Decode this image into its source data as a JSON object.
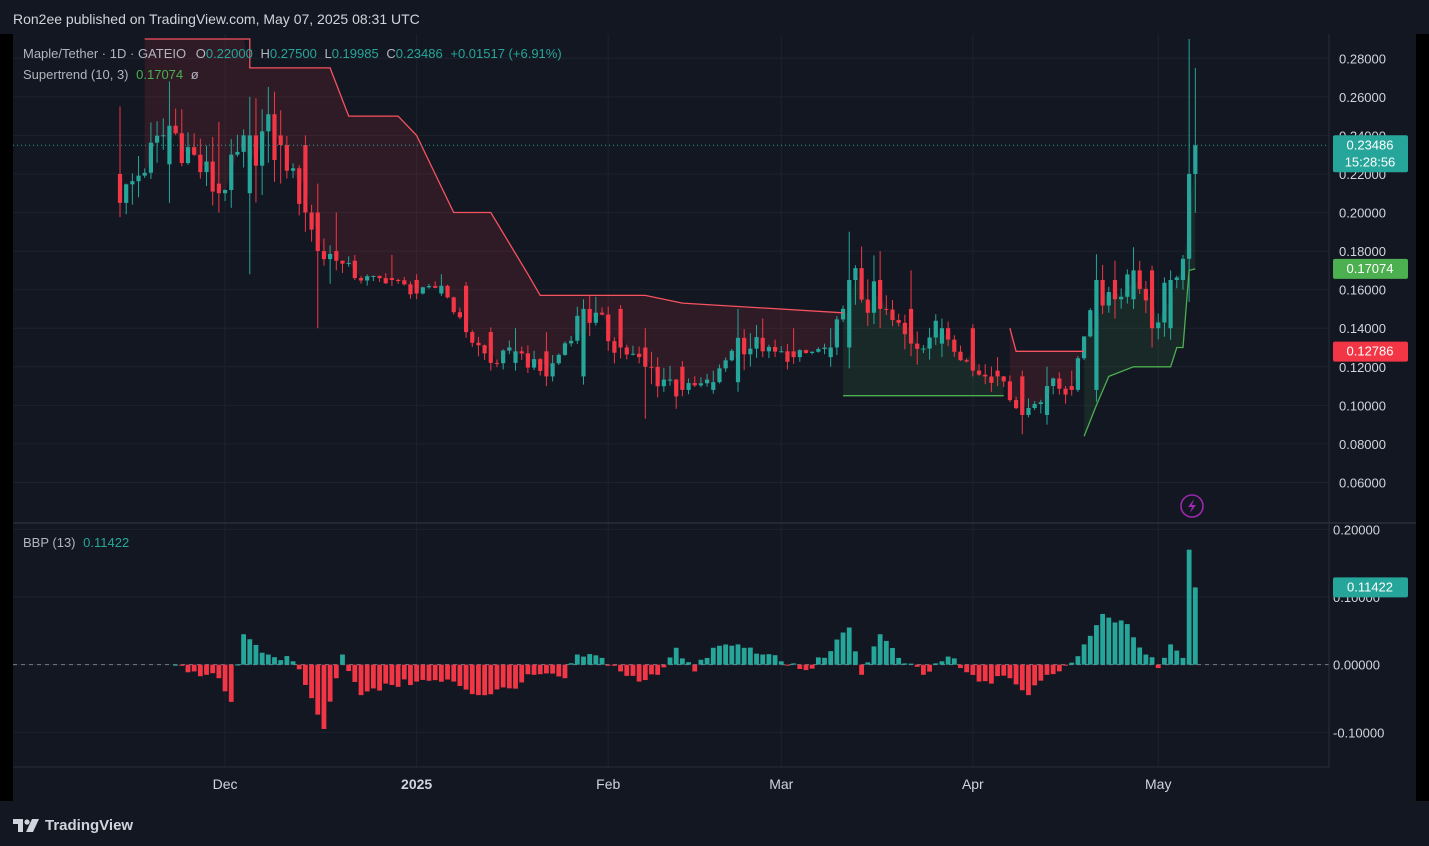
{
  "header": {
    "published_text": "Ron2ee published on TradingView.com, May 07, 2025 08:31 UTC"
  },
  "footer": {
    "brand": "TradingView"
  },
  "symbol": {
    "name": "Maple/Tether",
    "interval": "1D",
    "exchange": "GATEIO",
    "open_label": "O",
    "open": "0.22000",
    "high_label": "H",
    "high": "0.27500",
    "low_label": "L",
    "low": "0.19985",
    "close_label": "C",
    "close": "0.23486",
    "change": "+0.01517 (+6.91%)"
  },
  "supertrend": {
    "label": "Supertrend (10, 3)",
    "value": "0.17074",
    "suffix": "ø"
  },
  "bbp": {
    "label": "BBP (13)",
    "value": "0.11422"
  },
  "price_tags": {
    "last_price": "0.23486",
    "countdown": "15:28:56",
    "supertrend": "0.17074",
    "other": "0.12786"
  },
  "colors": {
    "up": "#26a69a",
    "down": "#f23645",
    "supertrend_up": "#4caf50",
    "supertrend_down": "#f7525f",
    "background": "#131722",
    "grid": "#1e222d"
  },
  "chart_data": {
    "type": "candlestick",
    "title": "Maple/Tether · 1D · GATEIO",
    "x_tick_labels": [
      "Dec",
      "2025",
      "Feb",
      "Mar",
      "Apr",
      "May"
    ],
    "x_tick_dates": [
      "2024-12-01",
      "2025-01-01",
      "2025-02-01",
      "2025-03-01",
      "2025-04-01",
      "2025-05-01"
    ],
    "price_axis": {
      "ticks": [
        "0.06000",
        "0.08000",
        "0.10000",
        "0.12000",
        "0.14000",
        "0.16000",
        "0.18000",
        "0.20000",
        "0.22000",
        "0.24000",
        "0.26000",
        "0.28000"
      ],
      "ylim": [
        0.04,
        0.29
      ]
    },
    "bbp_axis": {
      "ticks": [
        "-0.10000",
        "0.00000",
        "0.10000",
        "0.20000"
      ],
      "ylim": [
        -0.135,
        0.205
      ]
    },
    "anchors": [
      [
        "2024-11-14",
        0.22,
        0.255,
        0.2,
        0.205
      ],
      [
        "2024-11-22",
        0.225,
        0.268,
        0.205,
        0.245
      ],
      [
        "2024-11-30",
        0.215,
        0.247,
        0.2,
        0.21
      ],
      [
        "2024-12-05",
        0.21,
        0.26,
        0.168,
        0.24
      ],
      [
        "2024-12-10",
        0.24,
        0.253,
        0.215,
        0.235
      ],
      [
        "2024-12-14",
        0.235,
        0.24,
        0.19,
        0.2
      ],
      [
        "2024-12-16",
        0.2,
        0.215,
        0.14,
        0.18
      ],
      [
        "2024-12-19",
        0.18,
        0.2,
        0.17,
        0.175
      ],
      [
        "2024-12-22",
        0.175,
        0.178,
        0.165,
        0.166
      ],
      [
        "2024-12-28",
        0.166,
        0.178,
        0.163,
        0.165
      ],
      [
        "2025-01-01",
        0.165,
        0.168,
        0.155,
        0.158
      ],
      [
        "2025-01-05",
        0.158,
        0.168,
        0.157,
        0.162
      ],
      [
        "2025-01-09",
        0.162,
        0.163,
        0.135,
        0.138
      ],
      [
        "2025-01-13",
        0.138,
        0.14,
        0.118,
        0.122
      ],
      [
        "2025-01-17",
        0.122,
        0.14,
        0.118,
        0.128
      ],
      [
        "2025-01-22",
        0.128,
        0.138,
        0.11,
        0.115
      ],
      [
        "2025-01-28",
        0.115,
        0.155,
        0.113,
        0.15
      ],
      [
        "2025-02-03",
        0.15,
        0.152,
        0.125,
        0.13
      ],
      [
        "2025-02-07",
        0.13,
        0.14,
        0.093,
        0.12
      ],
      [
        "2025-02-13",
        0.12,
        0.123,
        0.105,
        0.108
      ],
      [
        "2025-02-18",
        0.108,
        0.118,
        0.106,
        0.112
      ],
      [
        "2025-02-22",
        0.112,
        0.15,
        0.108,
        0.135
      ],
      [
        "2025-02-26",
        0.135,
        0.145,
        0.125,
        0.128
      ],
      [
        "2025-03-03",
        0.128,
        0.14,
        0.122,
        0.125
      ],
      [
        "2025-03-09",
        0.125,
        0.14,
        0.12,
        0.13
      ],
      [
        "2025-03-12",
        0.13,
        0.19,
        0.125,
        0.165
      ],
      [
        "2025-03-17",
        0.165,
        0.18,
        0.14,
        0.15
      ],
      [
        "2025-03-22",
        0.15,
        0.17,
        0.13,
        0.132
      ],
      [
        "2025-03-27",
        0.132,
        0.145,
        0.125,
        0.14
      ],
      [
        "2025-04-01",
        0.14,
        0.142,
        0.115,
        0.118
      ],
      [
        "2025-04-05",
        0.118,
        0.125,
        0.11,
        0.115
      ],
      [
        "2025-04-09",
        0.115,
        0.118,
        0.085,
        0.095
      ],
      [
        "2025-04-13",
        0.095,
        0.12,
        0.09,
        0.11
      ],
      [
        "2025-04-17",
        0.11,
        0.118,
        0.105,
        0.108
      ],
      [
        "2025-04-21",
        0.108,
        0.17,
        0.105,
        0.165
      ],
      [
        "2025-04-24",
        0.165,
        0.175,
        0.145,
        0.155
      ],
      [
        "2025-04-27",
        0.155,
        0.182,
        0.15,
        0.17
      ],
      [
        "2025-04-30",
        0.17,
        0.172,
        0.13,
        0.14
      ],
      [
        "2025-05-03",
        0.14,
        0.17,
        0.138,
        0.165
      ],
      [
        "2025-05-05",
        0.165,
        0.178,
        0.16,
        0.176
      ],
      [
        "2025-05-06",
        0.176,
        0.29,
        0.17,
        0.22
      ],
      [
        "2025-05-07",
        0.22,
        0.275,
        0.19985,
        0.23486
      ]
    ],
    "supertrend": {
      "down_segments": [
        [
          [
            "2024-11-18",
            0.29
          ],
          [
            "2024-12-05",
            0.29
          ],
          [
            "2024-12-05",
            0.275
          ],
          [
            "2024-12-18",
            0.275
          ],
          [
            "2024-12-21",
            0.25
          ],
          [
            "2024-12-29",
            0.25
          ],
          [
            "2025-01-01",
            0.24
          ],
          [
            "2025-01-07",
            0.2
          ],
          [
            "2025-01-13",
            0.2
          ],
          [
            "2025-01-19",
            0.168
          ],
          [
            "2025-01-21",
            0.157
          ],
          [
            "2025-02-07",
            0.157
          ],
          [
            "2025-02-13",
            0.153
          ],
          [
            "2025-03-11",
            0.148
          ]
        ],
        [
          [
            "2025-04-07",
            0.14
          ],
          [
            "2025-04-08",
            0.128
          ],
          [
            "2025-04-17",
            0.128
          ],
          [
            "2025-04-19",
            0.128
          ]
        ]
      ],
      "up_segments": [
        [
          [
            "2025-03-11",
            0.105
          ],
          [
            "2025-04-06",
            0.105
          ]
        ],
        [
          [
            "2025-04-19",
            0.084
          ],
          [
            "2025-04-21",
            0.1
          ],
          [
            "2025-04-23",
            0.115
          ],
          [
            "2025-04-27",
            0.12
          ],
          [
            "2025-05-03",
            0.12
          ],
          [
            "2025-05-04",
            0.13
          ],
          [
            "2025-05-05",
            0.13
          ],
          [
            "2025-05-06",
            0.17
          ],
          [
            "2025-05-07",
            0.17074
          ]
        ]
      ]
    },
    "bbp_anchors": [
      [
        "2024-11-23",
        0.0
      ],
      [
        "2024-11-26",
        -0.01
      ],
      [
        "2024-11-28",
        -0.015
      ],
      [
        "2024-11-30",
        -0.02
      ],
      [
        "2024-12-02",
        -0.055
      ],
      [
        "2024-12-04",
        0.045
      ],
      [
        "2024-12-08",
        0.015
      ],
      [
        "2024-12-12",
        0.005
      ],
      [
        "2024-12-14",
        -0.03
      ],
      [
        "2024-12-17",
        -0.095
      ],
      [
        "2024-12-20",
        0.015
      ],
      [
        "2024-12-23",
        -0.045
      ],
      [
        "2024-12-28",
        -0.03
      ],
      [
        "2025-01-01",
        -0.025
      ],
      [
        "2025-01-07",
        -0.025
      ],
      [
        "2025-01-11",
        -0.045
      ],
      [
        "2025-01-16",
        -0.035
      ],
      [
        "2025-01-20",
        -0.015
      ],
      [
        "2025-01-25",
        -0.02
      ],
      [
        "2025-01-27",
        0.015
      ],
      [
        "2025-01-31",
        0.01
      ],
      [
        "2025-02-03",
        -0.01
      ],
      [
        "2025-02-06",
        -0.025
      ],
      [
        "2025-02-09",
        -0.015
      ],
      [
        "2025-02-12",
        0.025
      ],
      [
        "2025-02-15",
        -0.01
      ],
      [
        "2025-02-18",
        0.025
      ],
      [
        "2025-02-22",
        0.03
      ],
      [
        "2025-02-26",
        0.015
      ],
      [
        "2025-03-01",
        0.005
      ],
      [
        "2025-03-05",
        -0.008
      ],
      [
        "2025-03-09",
        0.02
      ],
      [
        "2025-03-12",
        0.055
      ],
      [
        "2025-03-14",
        -0.015
      ],
      [
        "2025-03-17",
        0.045
      ],
      [
        "2025-03-20",
        0.01
      ],
      [
        "2025-03-24",
        -0.015
      ],
      [
        "2025-03-28",
        0.012
      ],
      [
        "2025-03-30",
        -0.005
      ],
      [
        "2025-04-02",
        -0.025
      ],
      [
        "2025-04-07",
        -0.02
      ],
      [
        "2025-04-10",
        -0.045
      ],
      [
        "2025-04-13",
        -0.015
      ],
      [
        "2025-04-17",
        0.003
      ],
      [
        "2025-04-19",
        0.03
      ],
      [
        "2025-04-22",
        0.075
      ],
      [
        "2025-04-26",
        0.06
      ],
      [
        "2025-04-29",
        0.015
      ],
      [
        "2025-05-01",
        -0.005
      ],
      [
        "2025-05-03",
        0.03
      ],
      [
        "2025-05-05",
        0.01
      ],
      [
        "2025-05-06",
        0.17
      ],
      [
        "2025-05-07",
        0.11422
      ]
    ]
  }
}
